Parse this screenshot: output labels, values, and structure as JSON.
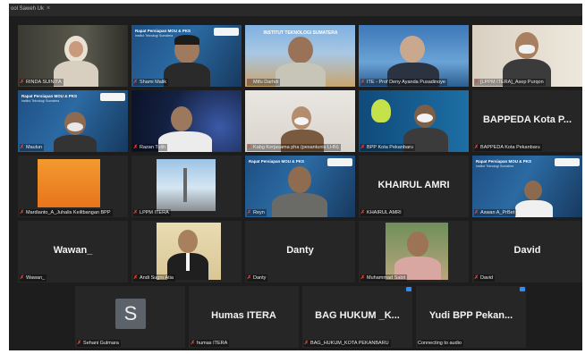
{
  "window": {
    "title": "ool Saweh Uk",
    "close": "×"
  },
  "participants": [
    {
      "id": "rinda",
      "label": "RINDA SUINITA",
      "kind": "video"
    },
    {
      "id": "shami",
      "label": "Shami Malik",
      "kind": "video"
    },
    {
      "id": "muhardi",
      "label": "Mtfu Darhdi",
      "kind": "video"
    },
    {
      "id": "ite",
      "label": "ITE - Prof Deny Ayanda Pusadinoye",
      "kind": "video"
    },
    {
      "id": "lppm1",
      "label": "[LPPM ITERA]_Asep Purqon",
      "kind": "video"
    },
    {
      "id": "maulun",
      "label": "Maulun",
      "kind": "video"
    },
    {
      "id": "nazari",
      "label": "Razan Tulih",
      "kind": "video"
    },
    {
      "id": "kabag",
      "label": "Kabg Kerjasama pha (pesantunis LHN)",
      "kind": "video"
    },
    {
      "id": "bpp",
      "label": "BPP Kota Pekanbaru",
      "kind": "video"
    },
    {
      "id": "bappeda",
      "label": "BAPPEDA Kota Pekanbaru",
      "kind": "name",
      "display": "BAPPEDA Kota P..."
    },
    {
      "id": "mardianto",
      "label": "Mardianto_A_Juhalis Keiltbangan BPP",
      "kind": "video"
    },
    {
      "id": "lppm2",
      "label": "LPPM ITERA",
      "kind": "video"
    },
    {
      "id": "reyn",
      "label": "Reyn",
      "kind": "video"
    },
    {
      "id": "khairul",
      "label": "KHAIRUL AMRI",
      "kind": "name",
      "display": "KHAIRUL AMRI"
    },
    {
      "id": "aswan",
      "label": "Aswan A_PrBet",
      "kind": "video"
    },
    {
      "id": "wawan",
      "label": "Wawan_",
      "kind": "name",
      "display": "Wawan_"
    },
    {
      "id": "andi",
      "label": "Andi Sugro Atia",
      "kind": "video"
    },
    {
      "id": "danty",
      "label": "Danty",
      "kind": "name",
      "display": "Danty"
    },
    {
      "id": "muhammad",
      "label": "Muhammad Sabit",
      "kind": "video"
    },
    {
      "id": "david",
      "label": "David",
      "kind": "name",
      "display": "David"
    },
    {
      "id": "sehani",
      "label": "Sehani Gulmara",
      "kind": "avatar",
      "initial": "S"
    },
    {
      "id": "humas",
      "label": "humas ITERA",
      "kind": "name",
      "display": "Humas ITERA"
    },
    {
      "id": "baghukum",
      "label": "BAG_HUKUM_KOTA PEKANBARU",
      "kind": "name",
      "display": "BAG HUKUM _K..."
    },
    {
      "id": "yudi",
      "label": "Connecting to audio",
      "kind": "name",
      "display": "Yudi BPP Pekan..."
    }
  ],
  "slide": {
    "title": "Rapat Persiapan MOU & PKS",
    "subtitle": "Institut Teknologi Sumatera"
  },
  "banner": {
    "text": "INSTITUT TEKNOLOGI SUMATERA"
  },
  "colors": {
    "active_border": "#c9d24a",
    "mic_muted": "#e0443a",
    "bg": "#1d1d1d"
  }
}
